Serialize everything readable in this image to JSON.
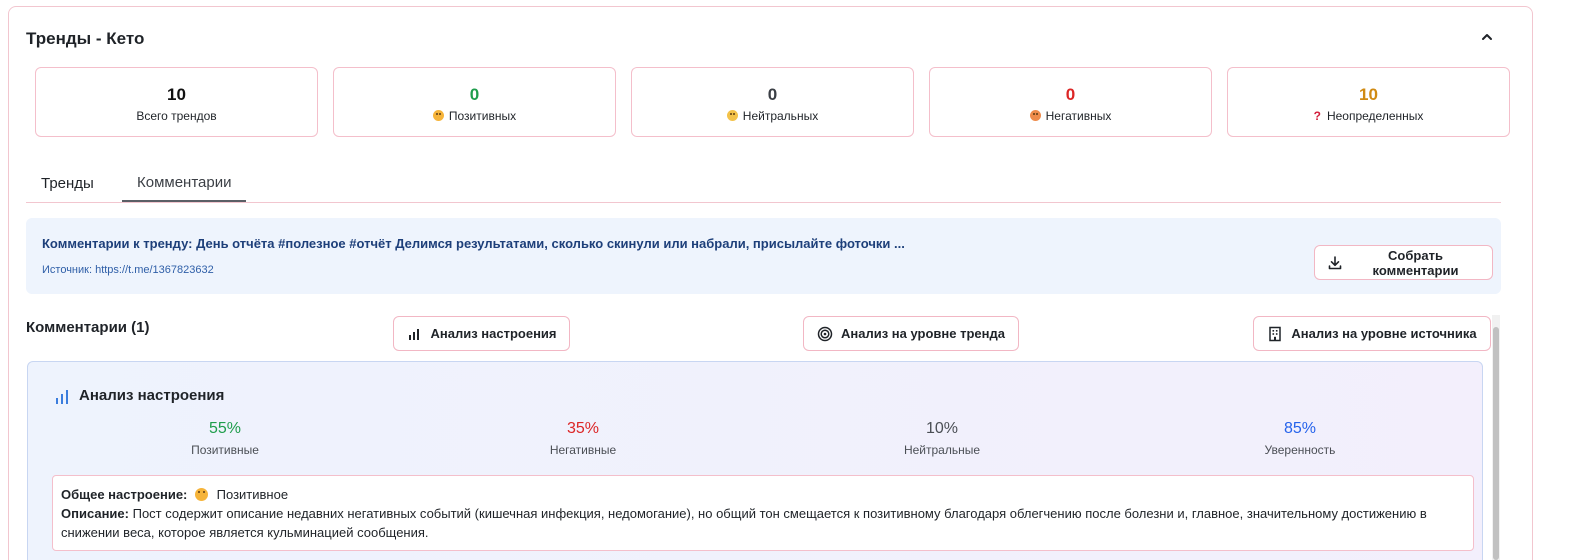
{
  "header": {
    "title": "Тренды - Кето"
  },
  "stats": [
    {
      "value": "10",
      "label": "Всего трендов",
      "color": "#111111",
      "icon": ""
    },
    {
      "value": "0",
      "label": "Позитивных",
      "color": "#1f9d4c",
      "icon": "smiling-face-icon"
    },
    {
      "value": "0",
      "label": "Нейтральных",
      "color": "#3b3f45",
      "icon": "neutral-face-icon"
    },
    {
      "value": "0",
      "label": "Негативных",
      "color": "#dc2626",
      "icon": "sad-face-icon"
    },
    {
      "value": "10",
      "label": "Неопределенных",
      "color": "#d08a12",
      "icon": "question-mark-icon"
    }
  ],
  "tabs": [
    {
      "label": "Тренды",
      "active": false
    },
    {
      "label": "Комментарии",
      "active": true
    }
  ],
  "info": {
    "title": "Комментарии к тренду: День отчёта #полезное #отчёт Делимся результатами, сколько скинули или набрали, присылайте фоточки ...",
    "source": "Источник: https://t.me/1367823632",
    "collect_button": "Собрать комментарии"
  },
  "comments": {
    "heading": "Комментарии (1)",
    "sentiment_button": "Анализ настроения",
    "trend_button": "Анализ на уровне тренда",
    "source_button": "Анализ на уровне источника"
  },
  "analysis": {
    "title": "Анализ настроения",
    "metrics": [
      {
        "value": "55%",
        "label": "Позитивные",
        "color": "#1f9d4c"
      },
      {
        "value": "35%",
        "label": "Негативные",
        "color": "#dc2626"
      },
      {
        "value": "10%",
        "label": "Нейтральные",
        "color": "#4b4f55"
      },
      {
        "value": "85%",
        "label": "Уверенность",
        "color": "#2563eb"
      }
    ],
    "overall_label": "Общее настроение:",
    "overall_value": "Позитивное",
    "description_label": "Описание:",
    "description": "Пост содержит описание недавних негативных событий (кишечная инфекция, недомогание), но общий тон смещается к позитивному благодаря облегчению после болезни и, главное, значительному достижению в снижении веса, которое является кульминацией сообщения."
  }
}
